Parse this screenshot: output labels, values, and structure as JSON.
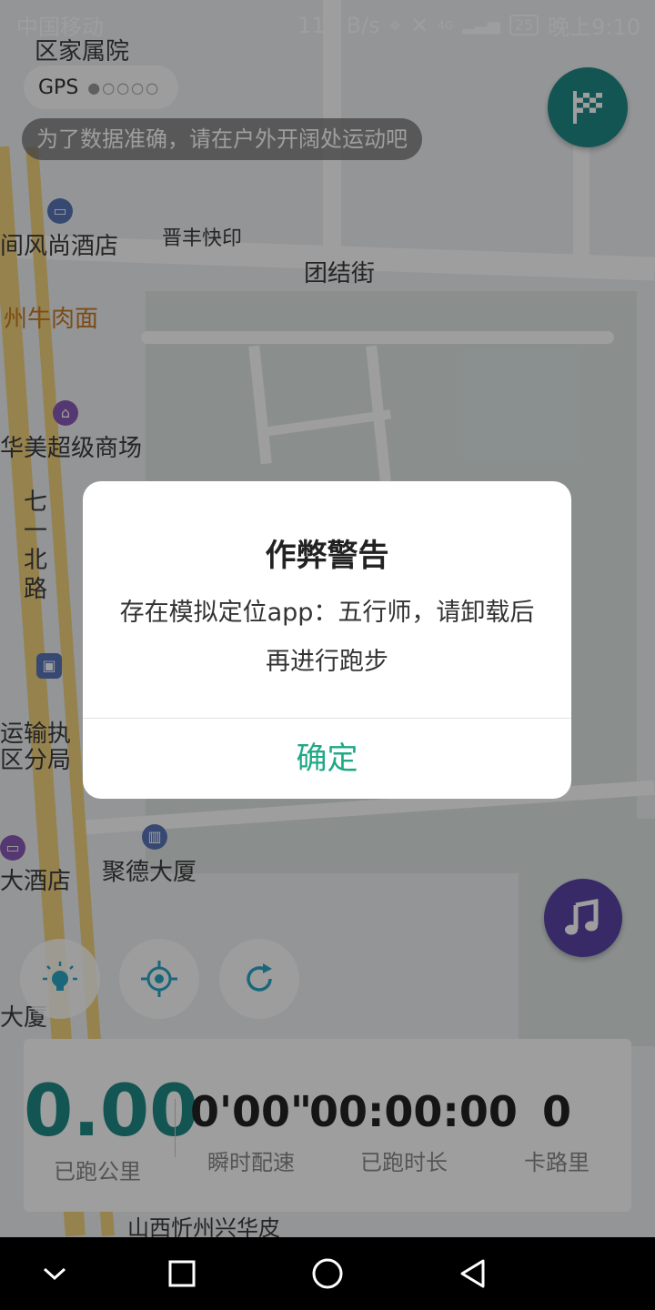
{
  "status_bar": {
    "carrier": "中国移动",
    "net_speed": "115 B/s",
    "network": "4G",
    "battery": "25",
    "time": "晚上9:10"
  },
  "map": {
    "labels": [
      {
        "text": "区家属院",
        "name": "map-label-jiashuyuan"
      },
      {
        "text": "晋丰快印",
        "name": "map-label-jinfeng"
      },
      {
        "text": "团结街",
        "name": "map-label-tuanjie"
      },
      {
        "text": "间风尚酒店",
        "name": "map-label-hotel"
      },
      {
        "text": "州牛肉面",
        "name": "map-label-noodle"
      },
      {
        "text": "华美超级商场",
        "name": "map-label-mall"
      },
      {
        "text": "七一北路",
        "name": "map-label-qiyi"
      },
      {
        "text": "运输执",
        "name": "map-label-transport1"
      },
      {
        "text": "区分局",
        "name": "map-label-transport2"
      },
      {
        "text": "聚德大厦",
        "name": "map-label-jude"
      },
      {
        "text": "大酒店",
        "name": "map-label-dajiudian"
      },
      {
        "text": "大厦",
        "name": "map-label-dasha"
      },
      {
        "text": "山西忻州兴华皮",
        "name": "map-label-xinhua"
      }
    ]
  },
  "gps": {
    "label": "GPS",
    "signal": "●○○○○"
  },
  "hint": "为了数据准确，请在户外开阔处运动吧",
  "stats": {
    "distance": {
      "value": "0.00",
      "label": "已跑公里"
    },
    "pace": {
      "value": "0'00\"",
      "label": "瞬时配速"
    },
    "duration": {
      "value": "00:00:00",
      "label": "已跑时长"
    },
    "calories": {
      "value": "0",
      "label": "卡路里"
    }
  },
  "dialog": {
    "title": "作弊警告",
    "message": "存在模拟定位app：五行师，请卸载后再进行跑步",
    "confirm": "确定"
  },
  "icons": {
    "flag": "checkered-flag-icon",
    "light": "lightbulb-icon",
    "locate": "locate-icon",
    "refresh": "refresh-icon",
    "music": "music-note-icon"
  },
  "colors": {
    "accent": "#1fa987",
    "distance_value": "#1f8a86",
    "music": "#5b45a6"
  }
}
